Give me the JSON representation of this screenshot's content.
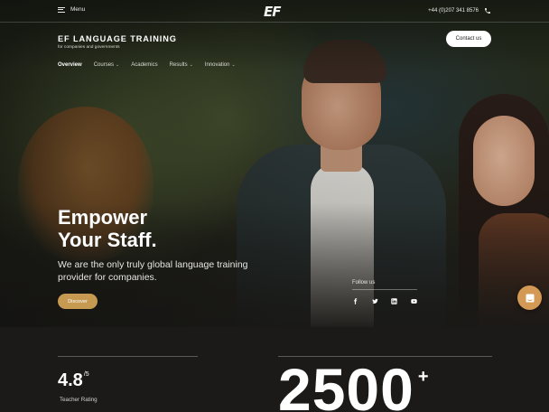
{
  "topbar": {
    "menu_label": "Menu",
    "logo": "EF",
    "phone": "+44 (0)207 341 8576"
  },
  "brand": {
    "name": "EF LANGUAGE TRAINING",
    "tagline": "for companies and governments"
  },
  "header": {
    "contact_label": "Contact us"
  },
  "nav": {
    "items": [
      {
        "label": "Overview",
        "has_caret": false,
        "active": true
      },
      {
        "label": "Courses",
        "has_caret": true,
        "active": false
      },
      {
        "label": "Academics",
        "has_caret": false,
        "active": false
      },
      {
        "label": "Results",
        "has_caret": true,
        "active": false
      },
      {
        "label": "Innovation",
        "has_caret": true,
        "active": false
      }
    ],
    "caret": "⌄"
  },
  "hero": {
    "headline_line1": "Empower",
    "headline_line2": "Your Staff.",
    "subline": "We are the only truly global language training provider for companies.",
    "cta_label": "Discover"
  },
  "follow": {
    "label": "Follow us",
    "icons": [
      "facebook-icon",
      "twitter-icon",
      "linkedin-icon",
      "youtube-icon"
    ]
  },
  "stats": {
    "rating_value": "4.8",
    "rating_scale": "/5",
    "rating_label": "Teacher Rating",
    "big_value": "2500",
    "big_suffix": "+"
  },
  "colors": {
    "background": "#1b1a18",
    "accent": "#c79a52",
    "chat": "#d49a55",
    "contact_button": "#ffffff"
  }
}
